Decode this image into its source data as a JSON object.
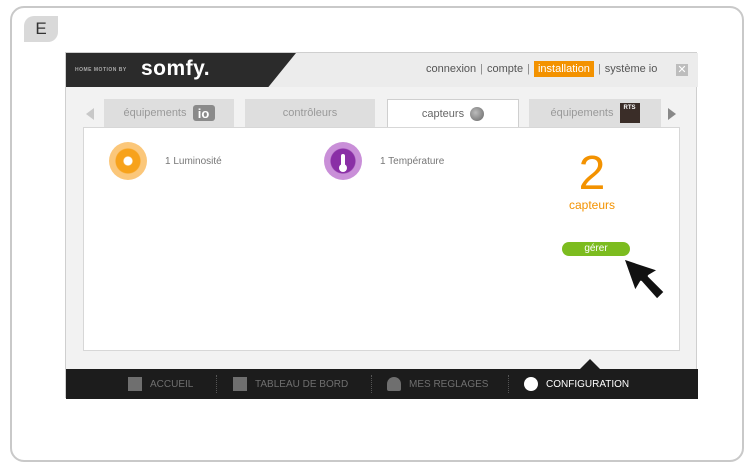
{
  "step_badge": "E",
  "brand": {
    "small": "HOME MOTION BY",
    "logo": "somfy."
  },
  "topnav": {
    "items": [
      "connexion",
      "compte",
      "installation",
      "système io"
    ],
    "active": "installation"
  },
  "tabs": [
    {
      "label": "équipements",
      "badge": "io"
    },
    {
      "label": "contrôleurs"
    },
    {
      "label": "capteurs",
      "active": true
    },
    {
      "label": "équipements",
      "badge": "RTS"
    }
  ],
  "sensors": [
    {
      "label": "1 Luminosité",
      "icon": "sun-icon"
    },
    {
      "label": "1 Température",
      "icon": "thermometer-icon"
    }
  ],
  "count": {
    "number": "2",
    "label": "capteurs"
  },
  "manage_button": "gérer",
  "bottom_nav": [
    "ACCUEIL",
    "TABLEAU DE BORD",
    "MES REGLAGES",
    "CONFIGURATION"
  ],
  "colors": {
    "accent": "#f39200",
    "button": "#7cbc1f",
    "dark": "#1c1c1c"
  }
}
